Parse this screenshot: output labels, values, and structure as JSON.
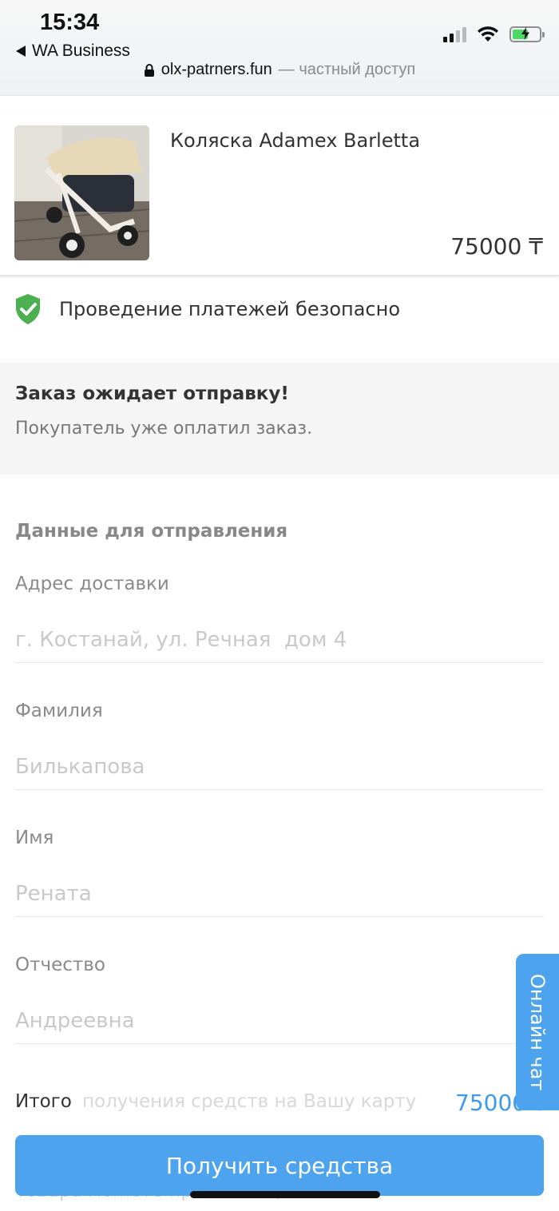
{
  "status_bar": {
    "time": "15:34",
    "back_app": "WA Business"
  },
  "browser": {
    "domain": "olx-patrners.fun",
    "access_note": "— частный доступ"
  },
  "product": {
    "title": "Коляска Adamex Barletta",
    "price": "75000 ₸",
    "photo_icon": "stroller-photo"
  },
  "security": {
    "icon": "shield-check-icon",
    "text": "Проведение платежей безопасно",
    "color": "#4caf50"
  },
  "order_status": {
    "title": "Заказ ожидает отправку!",
    "subtitle": "Покупатель уже оплатил заказ."
  },
  "form": {
    "section_title": "Данные для отправления",
    "fields": [
      {
        "label": "Адрес доставки",
        "placeholder": "г. Костанай, ул. Речная  дом 4"
      },
      {
        "label": "Фамилия",
        "placeholder": "Билькапова"
      },
      {
        "label": "Имя",
        "placeholder": "Рената"
      },
      {
        "label": "Отчество",
        "placeholder": "Андреевна"
      }
    ]
  },
  "summary": {
    "total_label": "Итого",
    "total_value": "75000 ₸",
    "hidden_note": "получения средств на Вашу карту",
    "hidden_note_2": "товара можете при ... специальной"
  },
  "actions": {
    "receive_funds": "Получить средства"
  },
  "chat": {
    "label": "Онлайн чат"
  },
  "colors": {
    "accent": "#4da3ee",
    "price_accent": "#3d9ae8",
    "status_bg": "#f5f5f5"
  }
}
